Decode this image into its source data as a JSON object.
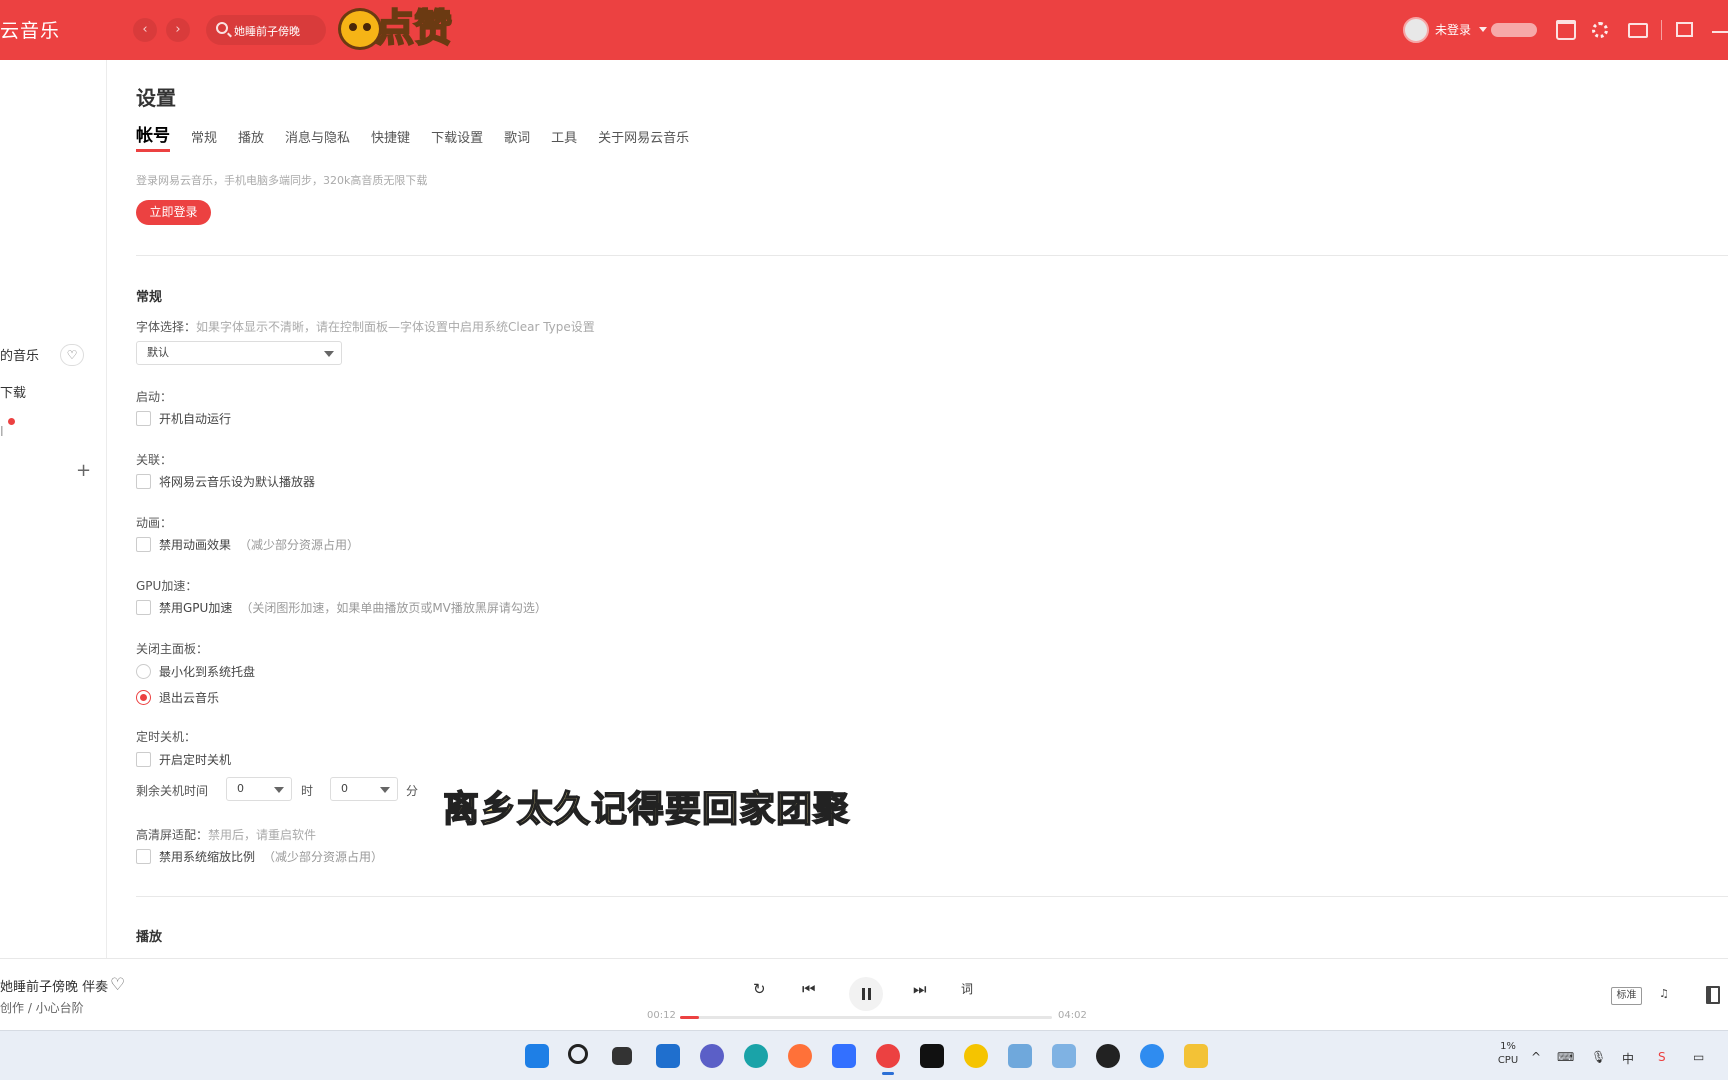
{
  "app": {
    "title": "云音乐",
    "search_placeholder": "她睡前子傍晚",
    "like_sticker_text": "点赞",
    "user_status": "未登录"
  },
  "sidebar": {
    "items": [
      {
        "label": "的音乐"
      },
      {
        "label": "下载"
      },
      {
        "label": "l"
      }
    ]
  },
  "settings": {
    "page_title": "设置",
    "tabs": [
      {
        "label": "帐号",
        "active": true
      },
      {
        "label": "常规"
      },
      {
        "label": "播放"
      },
      {
        "label": "消息与隐私"
      },
      {
        "label": "快捷键"
      },
      {
        "label": "下载设置"
      },
      {
        "label": "歌词"
      },
      {
        "label": "工具"
      },
      {
        "label": "关于网易云音乐"
      }
    ],
    "account": {
      "description": "登录网易云音乐，手机电脑多端同步，320k高音质无限下载",
      "login_button": "立即登录"
    },
    "general": {
      "section_title": "常规",
      "font": {
        "label": "字体选择：",
        "hint": "如果字体显示不清晰，请在控制面板—字体设置中启用系统Clear Type设置",
        "value": "默认"
      },
      "startup": {
        "label": "启动：",
        "option": "开机自动运行",
        "checked": false
      },
      "association": {
        "label": "关联：",
        "option": "将网易云音乐设为默认播放器",
        "checked": false
      },
      "animation": {
        "label": "动画：",
        "option": "禁用动画效果",
        "hint": "（减少部分资源占用）",
        "checked": false
      },
      "gpu": {
        "label": "GPU加速：",
        "option": "禁用GPU加速",
        "hint": "（关闭图形加速，如果单曲播放页或MV播放黑屏请勾选）",
        "checked": false
      },
      "close_panel": {
        "label": "关闭主面板：",
        "options": [
          {
            "label": "最小化到系统托盘",
            "selected": false
          },
          {
            "label": "退出云音乐",
            "selected": true
          }
        ]
      },
      "shutdown": {
        "label": "定时关机：",
        "option": "开启定时关机",
        "checked": false,
        "remaining_label": "剩余关机时间",
        "hours": "0",
        "hours_unit": "时",
        "minutes": "0",
        "minutes_unit": "分"
      },
      "hidpi": {
        "label": "高清屏适配：",
        "hint": "禁用后，请重启软件",
        "option": "禁用系统缩放比例",
        "option_hint": "（减少部分资源占用）",
        "checked": false
      }
    },
    "playback": {
      "section_title": "播放"
    }
  },
  "subtitle_overlay": "离乡太久记得要回家团聚",
  "player": {
    "song_title": "她睡前子傍晚 伴奏",
    "artist": "创作 / 小心台阶",
    "current_time": "00:12",
    "total_time": "04:02",
    "progress": 0.05,
    "quality": "标准"
  },
  "taskbar": {
    "cpu_percent": "1%",
    "cpu_label": "CPU",
    "ime": "中",
    "icons": [
      "windows-start",
      "search",
      "task-view",
      "widgets",
      "chat",
      "edge",
      "firefox",
      "feishu",
      "netease-music",
      "capcut",
      "qq-music",
      "network-tool",
      "network-tool-2",
      "obs",
      "kugou",
      "file-explorer"
    ]
  },
  "colors": {
    "brand": "#ec4141",
    "taskbar": "#e9eef6"
  }
}
